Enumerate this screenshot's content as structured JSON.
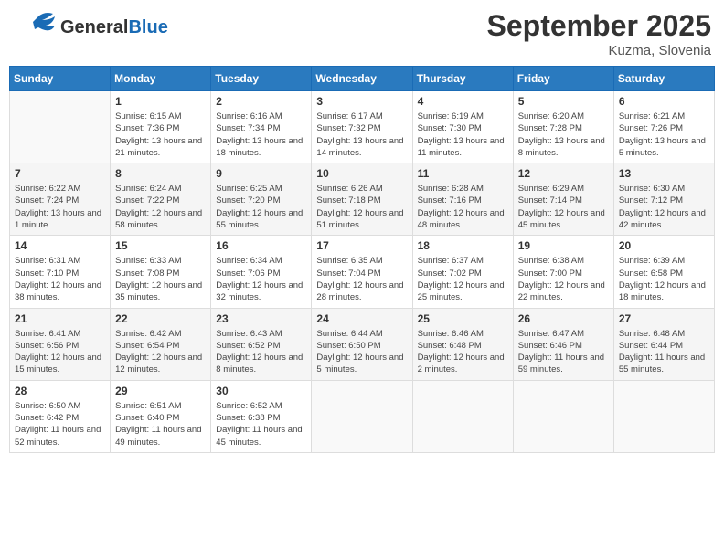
{
  "header": {
    "logo_general": "General",
    "logo_blue": "Blue",
    "month_title": "September 2025",
    "location": "Kuzma, Slovenia"
  },
  "days_of_week": [
    "Sunday",
    "Monday",
    "Tuesday",
    "Wednesday",
    "Thursday",
    "Friday",
    "Saturday"
  ],
  "weeks": [
    [
      {
        "day": "",
        "sunrise": "",
        "sunset": "",
        "daylight": ""
      },
      {
        "day": "1",
        "sunrise": "Sunrise: 6:15 AM",
        "sunset": "Sunset: 7:36 PM",
        "daylight": "Daylight: 13 hours and 21 minutes."
      },
      {
        "day": "2",
        "sunrise": "Sunrise: 6:16 AM",
        "sunset": "Sunset: 7:34 PM",
        "daylight": "Daylight: 13 hours and 18 minutes."
      },
      {
        "day": "3",
        "sunrise": "Sunrise: 6:17 AM",
        "sunset": "Sunset: 7:32 PM",
        "daylight": "Daylight: 13 hours and 14 minutes."
      },
      {
        "day": "4",
        "sunrise": "Sunrise: 6:19 AM",
        "sunset": "Sunset: 7:30 PM",
        "daylight": "Daylight: 13 hours and 11 minutes."
      },
      {
        "day": "5",
        "sunrise": "Sunrise: 6:20 AM",
        "sunset": "Sunset: 7:28 PM",
        "daylight": "Daylight: 13 hours and 8 minutes."
      },
      {
        "day": "6",
        "sunrise": "Sunrise: 6:21 AM",
        "sunset": "Sunset: 7:26 PM",
        "daylight": "Daylight: 13 hours and 5 minutes."
      }
    ],
    [
      {
        "day": "7",
        "sunrise": "Sunrise: 6:22 AM",
        "sunset": "Sunset: 7:24 PM",
        "daylight": "Daylight: 13 hours and 1 minute."
      },
      {
        "day": "8",
        "sunrise": "Sunrise: 6:24 AM",
        "sunset": "Sunset: 7:22 PM",
        "daylight": "Daylight: 12 hours and 58 minutes."
      },
      {
        "day": "9",
        "sunrise": "Sunrise: 6:25 AM",
        "sunset": "Sunset: 7:20 PM",
        "daylight": "Daylight: 12 hours and 55 minutes."
      },
      {
        "day": "10",
        "sunrise": "Sunrise: 6:26 AM",
        "sunset": "Sunset: 7:18 PM",
        "daylight": "Daylight: 12 hours and 51 minutes."
      },
      {
        "day": "11",
        "sunrise": "Sunrise: 6:28 AM",
        "sunset": "Sunset: 7:16 PM",
        "daylight": "Daylight: 12 hours and 48 minutes."
      },
      {
        "day": "12",
        "sunrise": "Sunrise: 6:29 AM",
        "sunset": "Sunset: 7:14 PM",
        "daylight": "Daylight: 12 hours and 45 minutes."
      },
      {
        "day": "13",
        "sunrise": "Sunrise: 6:30 AM",
        "sunset": "Sunset: 7:12 PM",
        "daylight": "Daylight: 12 hours and 42 minutes."
      }
    ],
    [
      {
        "day": "14",
        "sunrise": "Sunrise: 6:31 AM",
        "sunset": "Sunset: 7:10 PM",
        "daylight": "Daylight: 12 hours and 38 minutes."
      },
      {
        "day": "15",
        "sunrise": "Sunrise: 6:33 AM",
        "sunset": "Sunset: 7:08 PM",
        "daylight": "Daylight: 12 hours and 35 minutes."
      },
      {
        "day": "16",
        "sunrise": "Sunrise: 6:34 AM",
        "sunset": "Sunset: 7:06 PM",
        "daylight": "Daylight: 12 hours and 32 minutes."
      },
      {
        "day": "17",
        "sunrise": "Sunrise: 6:35 AM",
        "sunset": "Sunset: 7:04 PM",
        "daylight": "Daylight: 12 hours and 28 minutes."
      },
      {
        "day": "18",
        "sunrise": "Sunrise: 6:37 AM",
        "sunset": "Sunset: 7:02 PM",
        "daylight": "Daylight: 12 hours and 25 minutes."
      },
      {
        "day": "19",
        "sunrise": "Sunrise: 6:38 AM",
        "sunset": "Sunset: 7:00 PM",
        "daylight": "Daylight: 12 hours and 22 minutes."
      },
      {
        "day": "20",
        "sunrise": "Sunrise: 6:39 AM",
        "sunset": "Sunset: 6:58 PM",
        "daylight": "Daylight: 12 hours and 18 minutes."
      }
    ],
    [
      {
        "day": "21",
        "sunrise": "Sunrise: 6:41 AM",
        "sunset": "Sunset: 6:56 PM",
        "daylight": "Daylight: 12 hours and 15 minutes."
      },
      {
        "day": "22",
        "sunrise": "Sunrise: 6:42 AM",
        "sunset": "Sunset: 6:54 PM",
        "daylight": "Daylight: 12 hours and 12 minutes."
      },
      {
        "day": "23",
        "sunrise": "Sunrise: 6:43 AM",
        "sunset": "Sunset: 6:52 PM",
        "daylight": "Daylight: 12 hours and 8 minutes."
      },
      {
        "day": "24",
        "sunrise": "Sunrise: 6:44 AM",
        "sunset": "Sunset: 6:50 PM",
        "daylight": "Daylight: 12 hours and 5 minutes."
      },
      {
        "day": "25",
        "sunrise": "Sunrise: 6:46 AM",
        "sunset": "Sunset: 6:48 PM",
        "daylight": "Daylight: 12 hours and 2 minutes."
      },
      {
        "day": "26",
        "sunrise": "Sunrise: 6:47 AM",
        "sunset": "Sunset: 6:46 PM",
        "daylight": "Daylight: 11 hours and 59 minutes."
      },
      {
        "day": "27",
        "sunrise": "Sunrise: 6:48 AM",
        "sunset": "Sunset: 6:44 PM",
        "daylight": "Daylight: 11 hours and 55 minutes."
      }
    ],
    [
      {
        "day": "28",
        "sunrise": "Sunrise: 6:50 AM",
        "sunset": "Sunset: 6:42 PM",
        "daylight": "Daylight: 11 hours and 52 minutes."
      },
      {
        "day": "29",
        "sunrise": "Sunrise: 6:51 AM",
        "sunset": "Sunset: 6:40 PM",
        "daylight": "Daylight: 11 hours and 49 minutes."
      },
      {
        "day": "30",
        "sunrise": "Sunrise: 6:52 AM",
        "sunset": "Sunset: 6:38 PM",
        "daylight": "Daylight: 11 hours and 45 minutes."
      },
      {
        "day": "",
        "sunrise": "",
        "sunset": "",
        "daylight": ""
      },
      {
        "day": "",
        "sunrise": "",
        "sunset": "",
        "daylight": ""
      },
      {
        "day": "",
        "sunrise": "",
        "sunset": "",
        "daylight": ""
      },
      {
        "day": "",
        "sunrise": "",
        "sunset": "",
        "daylight": ""
      }
    ]
  ]
}
